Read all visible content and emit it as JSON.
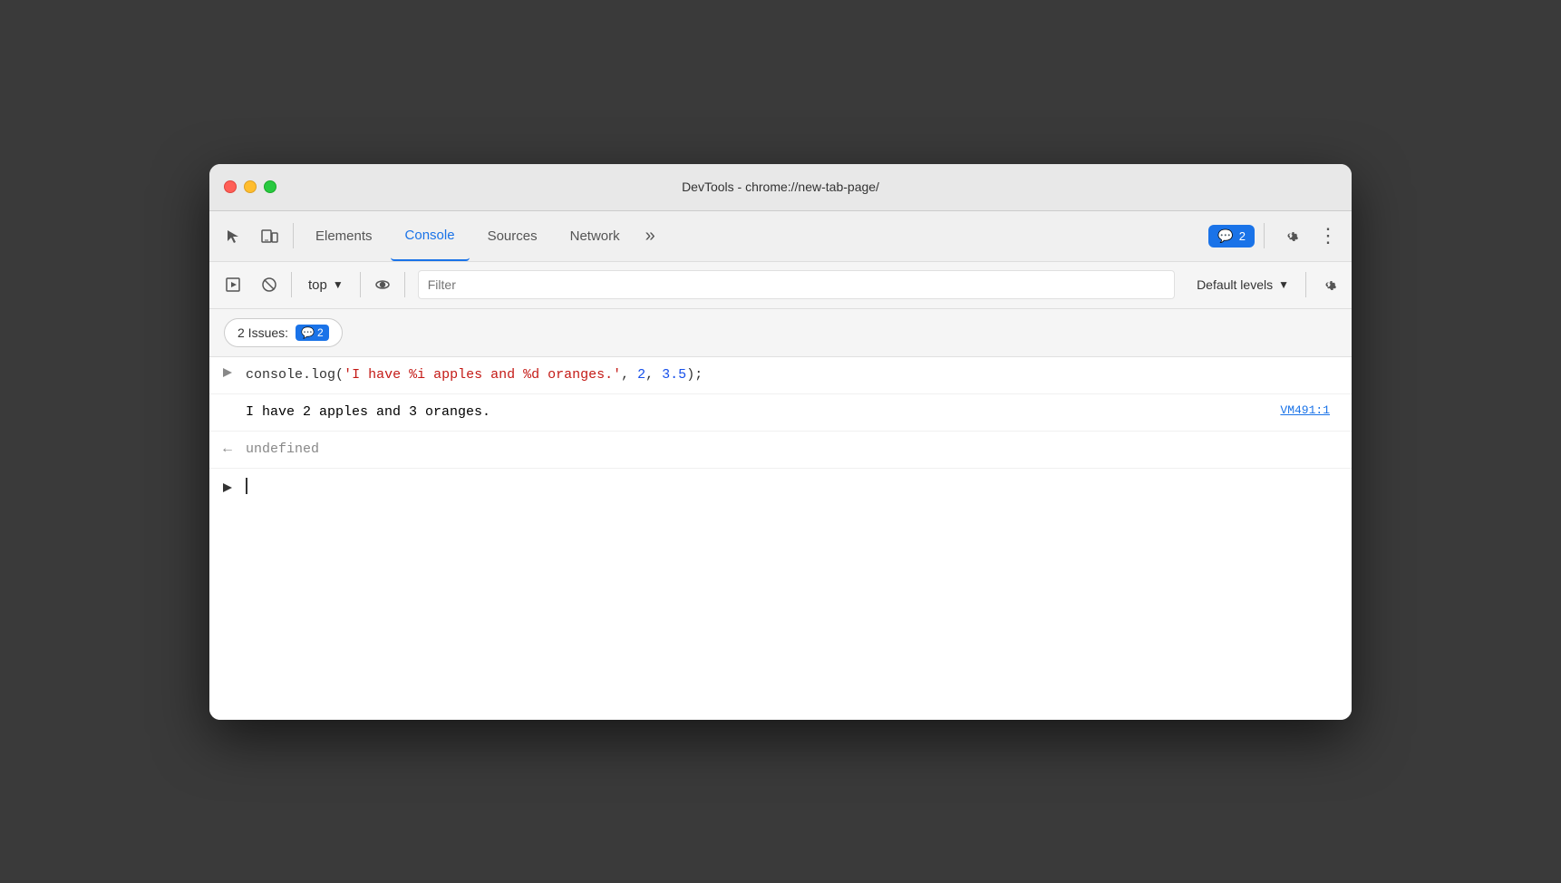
{
  "window": {
    "title": "DevTools - chrome://new-tab-page/"
  },
  "tabs": {
    "items": [
      {
        "id": "elements",
        "label": "Elements"
      },
      {
        "id": "console",
        "label": "Console"
      },
      {
        "id": "sources",
        "label": "Sources"
      },
      {
        "id": "network",
        "label": "Network"
      }
    ],
    "active": "console",
    "more_label": "»",
    "issues_count": "2",
    "issues_icon": "💬"
  },
  "console_toolbar": {
    "top_label": "top",
    "filter_placeholder": "Filter",
    "default_levels_label": "Default levels"
  },
  "issues_bar": {
    "prefix": "2 Issues:",
    "count": "2"
  },
  "console_lines": [
    {
      "type": "input",
      "arrow": ">",
      "code_parts": [
        {
          "text": "console",
          "style": "keyword"
        },
        {
          "text": ".",
          "style": "plain"
        },
        {
          "text": "log",
          "style": "plain"
        },
        {
          "text": "(",
          "style": "plain"
        },
        {
          "text": "'I have %i apples and %d oranges.'",
          "style": "string"
        },
        {
          "text": ", ",
          "style": "plain"
        },
        {
          "text": "2",
          "style": "number"
        },
        {
          "text": ", ",
          "style": "plain"
        },
        {
          "text": "3.5",
          "style": "number"
        },
        {
          "text": ");",
          "style": "plain"
        }
      ]
    },
    {
      "type": "output",
      "arrow": "",
      "text": "I have 2 apples and 3 oranges.",
      "link": "VM491:1"
    },
    {
      "type": "return",
      "arrow": "←",
      "text": "undefined"
    }
  ],
  "gear_icon_label": "⚙",
  "more_icon_label": "⋮",
  "settings": {
    "label": "Settings"
  }
}
